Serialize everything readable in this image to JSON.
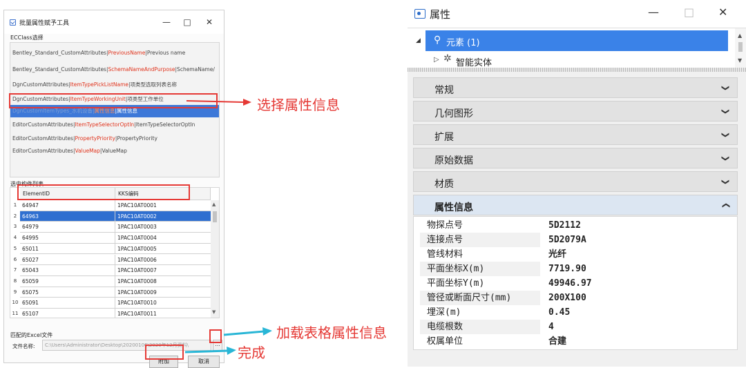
{
  "dialog": {
    "title": "批量属性赋予工具",
    "controls": {
      "minimize": "—",
      "maximize": "□",
      "close": "✕"
    },
    "class_group_label": "ECClass选择",
    "class_items": [
      {
        "prefix": "Bentley_Standard_CustomAttributes|",
        "red": "PreviousName",
        "suffix": "|Previous name"
      },
      {
        "prefix": "Bentley_Standard_CustomAttributes|",
        "red": "SchemaNameAndPurpose",
        "suffix": "|SchemaName/"
      },
      {
        "prefix": "DgnCustomAttributes|",
        "red": "ItemTypePickListName",
        "suffix": "|项类型选取列表名称"
      },
      {
        "prefix": "DgnCustomAttributes|",
        "red": "ItemTypeWorkingUnit",
        "suffix": "|项类型工作单位"
      },
      {
        "prefix": "DgnCustomItemTypes_水机设备|",
        "red": "属性信息",
        "suffix": "|属性信息"
      },
      {
        "prefix": "EditorCustomAttributes|",
        "red": "ItemTypeSelectorOptIn",
        "suffix": "|ItemTypeSelectorOptIn"
      },
      {
        "prefix": "EditorCustomAttributes|",
        "red": "PropertyPriority",
        "suffix": "|PropertyPriority"
      },
      {
        "prefix": "EditorCustomAttributes|",
        "red": "ValueMap",
        "suffix": "|ValueMap"
      }
    ],
    "table_group_label": "选中构件列表",
    "table_headers": [
      "ElementID",
      "KKS编码"
    ],
    "table_rows": [
      {
        "n": "1",
        "id": "64947",
        "kks": "1PAC10AT0001"
      },
      {
        "n": "2",
        "id": "64963",
        "kks": "1PAC10AT0002"
      },
      {
        "n": "3",
        "id": "64979",
        "kks": "1PAC10AT0003"
      },
      {
        "n": "4",
        "id": "64995",
        "kks": "1PAC10AT0004"
      },
      {
        "n": "5",
        "id": "65011",
        "kks": "1PAC10AT0005"
      },
      {
        "n": "6",
        "id": "65027",
        "kks": "1PAC10AT0006"
      },
      {
        "n": "7",
        "id": "65043",
        "kks": "1PAC10AT0007"
      },
      {
        "n": "8",
        "id": "65059",
        "kks": "1PAC10AT0008"
      },
      {
        "n": "9",
        "id": "65075",
        "kks": "1PAC10AT0009"
      },
      {
        "n": "10",
        "id": "65091",
        "kks": "1PAC10AT0010"
      },
      {
        "n": "11",
        "id": "65107",
        "kks": "1PAC10AT0011"
      }
    ],
    "excel_group_label": "匹配的Excel文件",
    "file_label": "文件名称:",
    "file_path": "C:\\Users\\Administrator\\Desktop\\20200106\\2020年12月资料\\",
    "browse_label": "...",
    "attach_label": "附加",
    "cancel_label": "取消"
  },
  "annotations": {
    "select_attr": "选择属性信息",
    "load_table": "加载表格属性信息",
    "done": "完成",
    "color": "#e53935",
    "arrow_color": "#29b6d6"
  },
  "panel": {
    "title": "属性",
    "controls": {
      "minimize": "—",
      "maximize": "□",
      "close": "✕"
    },
    "tree": {
      "element_label": "元素 (1)",
      "child_label": "智能实体"
    },
    "sections": [
      "常规",
      "几何图形",
      "扩展",
      "原始数据",
      "材质"
    ],
    "open_section": "属性信息",
    "properties": [
      {
        "key": "物探点号",
        "value": "5D2112"
      },
      {
        "key": "连接点号",
        "value": "5D2079A"
      },
      {
        "key": "管线材料",
        "value": "光纤"
      },
      {
        "key": "平面坐标X(m)",
        "value": "7719.90"
      },
      {
        "key": "平面坐标Y(m)",
        "value": "49946.97"
      },
      {
        "key": "管径或断面尺寸(mm)",
        "value": "200X100"
      },
      {
        "key": "埋深(m)",
        "value": "0.45"
      },
      {
        "key": "电缆根数",
        "value": "4"
      },
      {
        "key": "权属单位",
        "value": "合建"
      }
    ]
  }
}
